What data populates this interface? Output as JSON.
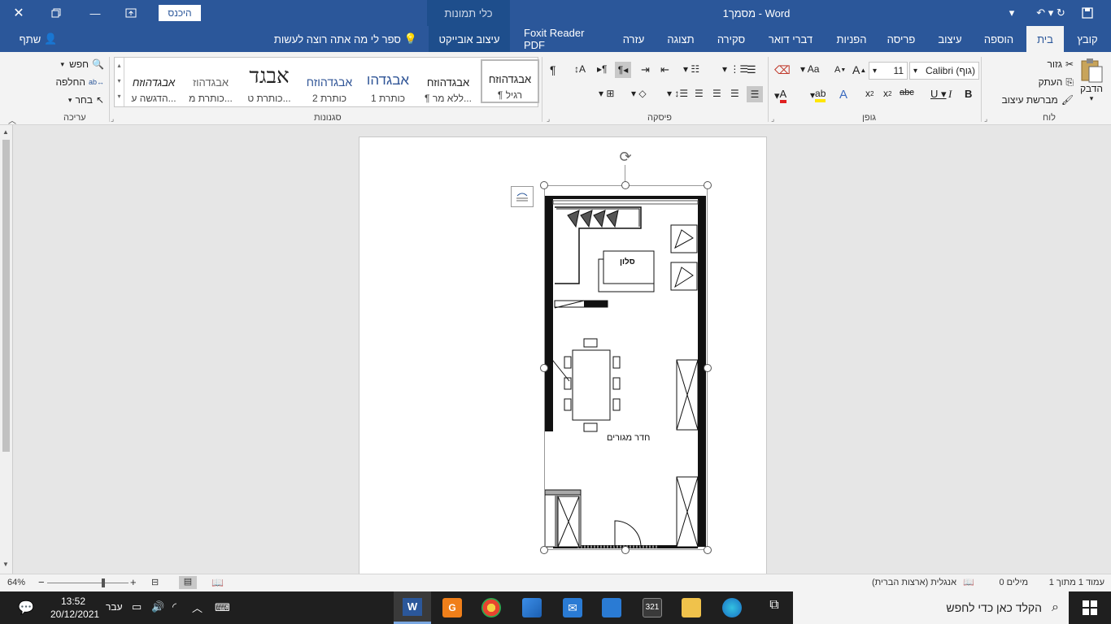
{
  "titlebar": {
    "title": "מסמך1 - Word",
    "contextual_tab": "כלי תמונות",
    "signin": "היכנס"
  },
  "menubar": {
    "tabs": [
      "קובץ",
      "בית",
      "הוספה",
      "עיצוב",
      "פריסה",
      "הפניות",
      "דברי דואר",
      "סקירה",
      "תצוגה",
      "עזרה",
      "Foxit Reader PDF",
      "עיצוב אובייקט"
    ],
    "tell_me": "ספר לי מה אתה רוצה לעשות",
    "share": "שתף"
  },
  "clipboard": {
    "paste": "הדבק",
    "cut": "גזור",
    "copy": "העתק",
    "format_painter": "מברשת עיצוב",
    "group": "לוח"
  },
  "font": {
    "name": "Calibri (גוף)",
    "size": "11",
    "group": "גופן"
  },
  "paragraph": {
    "group": "פיסקה"
  },
  "styles": {
    "group": "סגנונות",
    "items": [
      {
        "sample": "אבגדהוזח",
        "label": "¶ רגיל"
      },
      {
        "sample": "אבגדהוזח",
        "label": "¶ ללא מר..."
      },
      {
        "sample": "אבגדהו",
        "label": "כותרת 1"
      },
      {
        "sample": "אבגדהוזח",
        "label": "כותרת 2"
      },
      {
        "sample": "אבגד",
        "label": "כותרת ט..."
      },
      {
        "sample": "אבגדהוז",
        "label": "כותרת מ..."
      },
      {
        "sample": "אבגדהוזח",
        "label": "הדגשה ע..."
      }
    ]
  },
  "editing": {
    "find": "חפש",
    "replace": "החלפה",
    "select": "בחר",
    "group": "עריכה"
  },
  "drawing": {
    "salon": "סלון",
    "living": "חדר מגורים"
  },
  "status": {
    "page": "עמוד 1 מתוך 1",
    "words": "0 מילים",
    "language": "אנגלית (ארצות הברית)",
    "zoom": "64%"
  },
  "taskbar": {
    "search": "הקלד כאן כדי לחפש",
    "time": "13:52",
    "date": "20/12/2021",
    "lang": "עבר"
  }
}
